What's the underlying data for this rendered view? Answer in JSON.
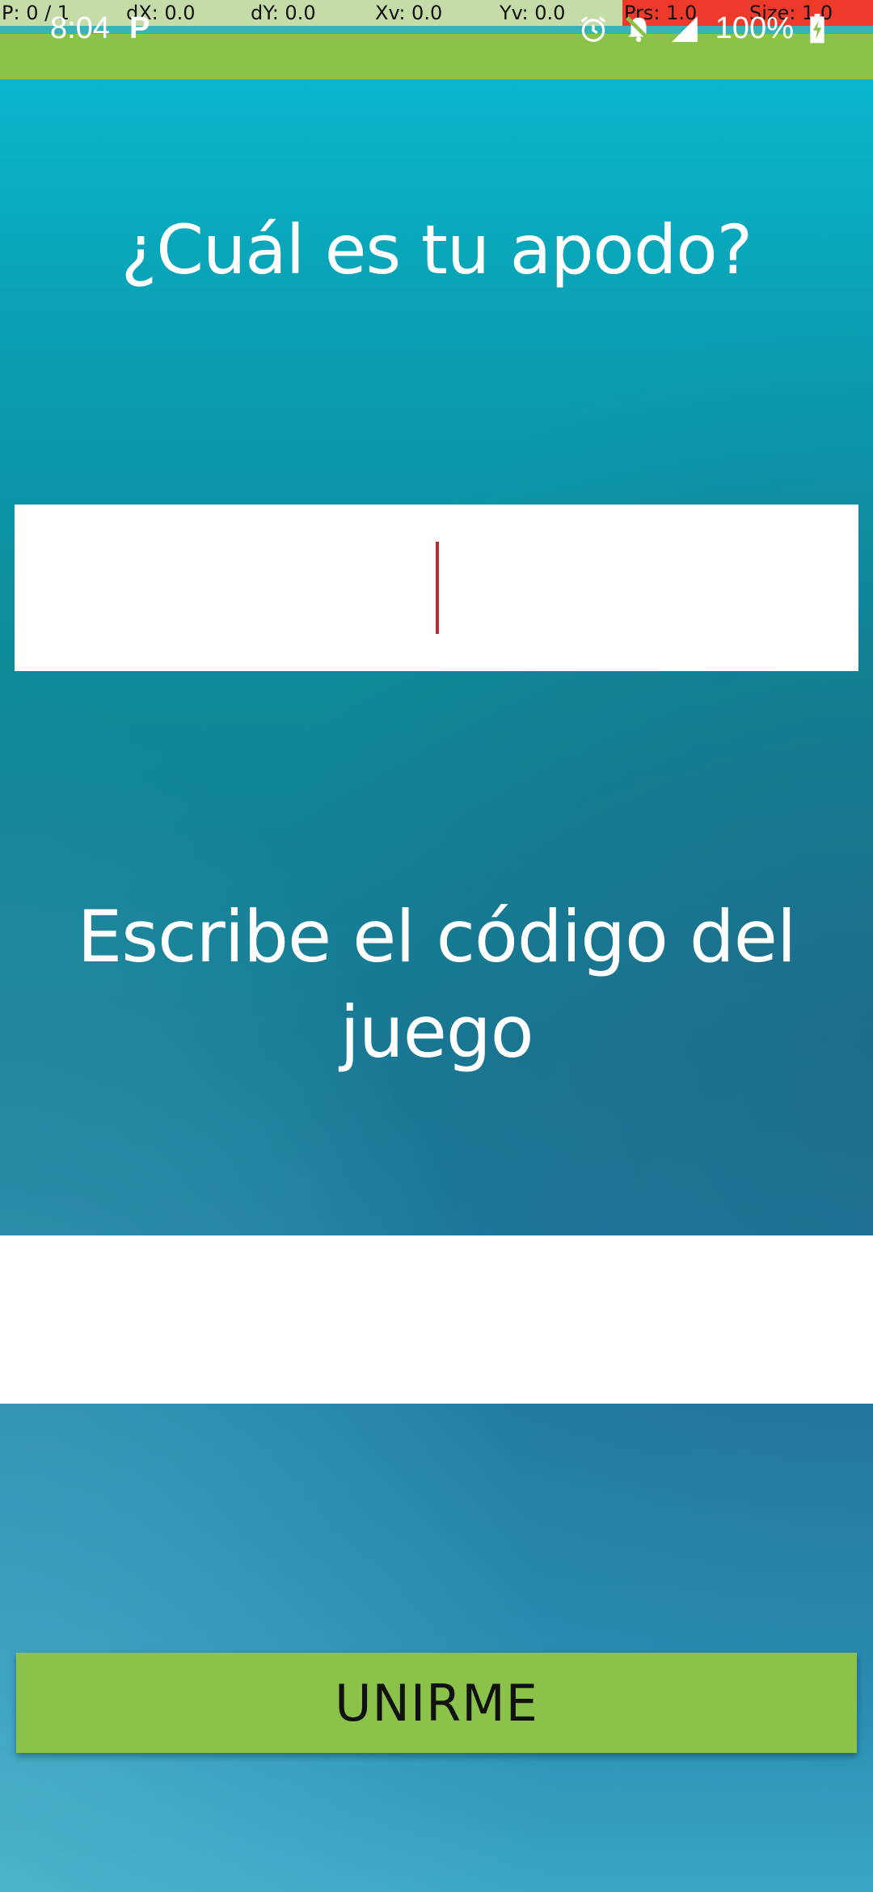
{
  "debug_overlay": {
    "pointer": "P: 0 / 1",
    "dx": "dX: 0.0",
    "dy": "dY: 0.0",
    "xv": "Xv: 0.0",
    "yv": "Yv: 0.0",
    "prs": "Prs: 1.0",
    "size": "Size: 1.0"
  },
  "status_bar": {
    "time": "8:04",
    "app_icon": "P",
    "icons": [
      "alarm-icon",
      "bell-off-icon",
      "cell-signal-icon"
    ],
    "battery": "100%",
    "background": "#8bc34a"
  },
  "screen": {
    "title": "¿Cuál es tu apodo?",
    "nickname_input": {
      "value": "",
      "placeholder": ""
    },
    "subtitle": "Escribe el código del juego",
    "game_code_input": {
      "value": "",
      "placeholder": ""
    },
    "join_button": "UNIRME"
  },
  "colors": {
    "accent_green": "#8bc34a",
    "caret_red": "#c62828",
    "background_teal": "#0e8a99"
  }
}
